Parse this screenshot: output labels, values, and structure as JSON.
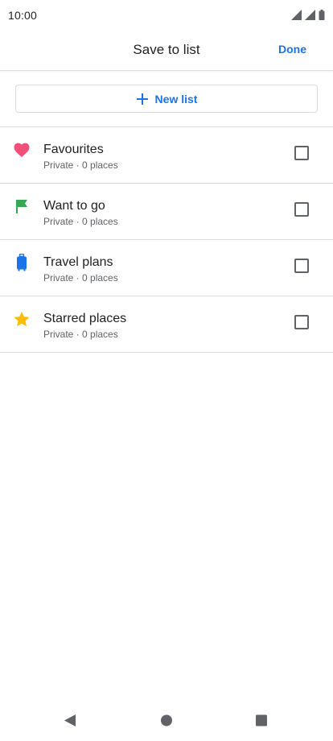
{
  "status": {
    "time": "10:00"
  },
  "header": {
    "title": "Save to list",
    "done_label": "Done"
  },
  "new_list": {
    "label": "New list"
  },
  "lists": [
    {
      "title": "Favourites",
      "subtitle": "Private · 0 places",
      "icon": "heart-icon",
      "color": "#f0507a"
    },
    {
      "title": "Want to go",
      "subtitle": "Private · 0 places",
      "icon": "flag-icon",
      "color": "#34a853"
    },
    {
      "title": "Travel plans",
      "subtitle": "Private · 0 places",
      "icon": "suitcase-icon",
      "color": "#1a73e8"
    },
    {
      "title": "Starred places",
      "subtitle": "Private · 0 places",
      "icon": "star-icon",
      "color": "#fbbc04"
    }
  ],
  "colors": {
    "accent": "#1a73e8",
    "divider": "#dadce0",
    "text_secondary": "#5f6368"
  }
}
